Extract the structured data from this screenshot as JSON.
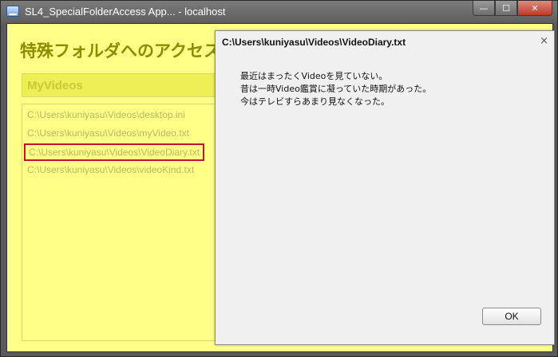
{
  "window": {
    "title": "SL4_SpecialFolderAccess App... - localhost",
    "minimize_glyph": "—",
    "maximize_glyph": "☐",
    "close_glyph": "✕"
  },
  "app": {
    "heading": "特殊フォルダへのアクセス",
    "folder_label": "MyVideos",
    "files": [
      "C:\\Users\\kuniyasu\\Videos\\desktop.ini",
      "C:\\Users\\kuniyasu\\Videos\\myVideo.txt",
      "C:\\Users\\kuniyasu\\Videos\\VideoDiary.txt",
      "C:\\Users\\kuniyasu\\Videos\\videoKind.txt"
    ],
    "selected_index": 2
  },
  "dialog": {
    "title": "C:\\Users\\kuniyasu\\Videos\\VideoDiary.txt",
    "close_glyph": "×",
    "lines": [
      "最近はまったくVideoを見ていない。",
      "昔は一時Video鑑賞に凝っていた時期があった。",
      "今はテレビすらあまり見なくなった。"
    ],
    "ok_label": "OK"
  },
  "colors": {
    "app_background": "#ffff88",
    "heading": "#8c8c00",
    "selection_border": "#c8102e"
  }
}
